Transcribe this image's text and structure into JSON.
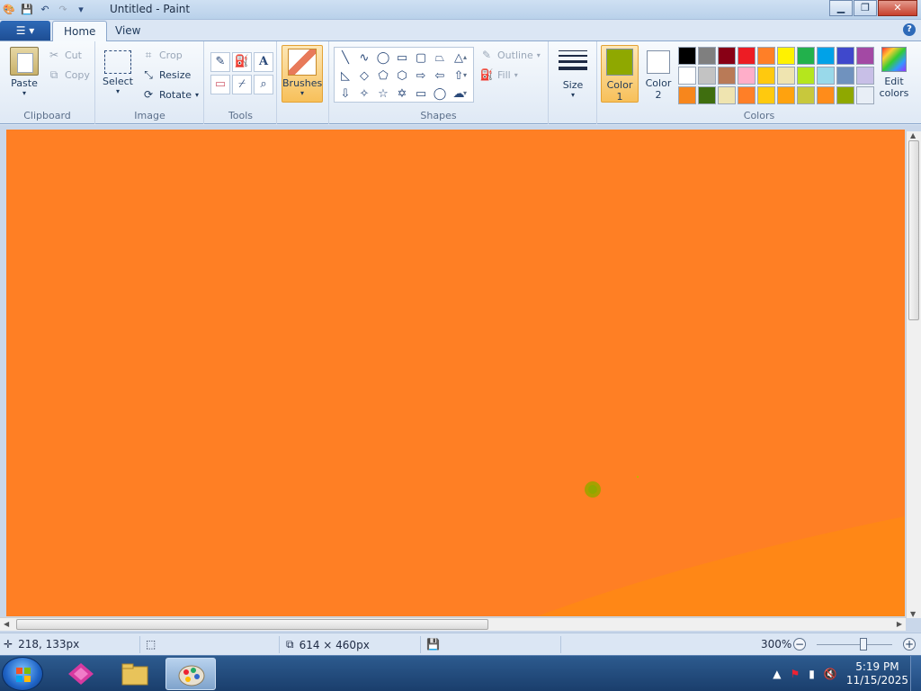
{
  "window": {
    "title": "Untitled - Paint",
    "minimize_icon": "minimize-icon",
    "maximize_icon": "restore-icon",
    "close_icon": "close-icon"
  },
  "tabs": {
    "home": "Home",
    "view": "View"
  },
  "ribbon": {
    "clipboard": {
      "label": "Clipboard",
      "paste": "Paste",
      "cut": "Cut",
      "copy": "Copy"
    },
    "image": {
      "label": "Image",
      "select": "Select",
      "crop": "Crop",
      "resize": "Resize",
      "rotate": "Rotate"
    },
    "tools": {
      "label": "Tools"
    },
    "brushes": {
      "label": "Brushes"
    },
    "shapes": {
      "label": "Shapes",
      "outline": "Outline",
      "fill": "Fill"
    },
    "size": {
      "label": "Size"
    },
    "colors": {
      "label": "Colors",
      "color1_line1": "Color",
      "color1_line2": "1",
      "color2_line1": "Color",
      "color2_line2": "2",
      "color1_value": "#8fa800",
      "color2_value": "#ffffff",
      "edit_line1": "Edit",
      "edit_line2": "colors",
      "palette": [
        "#000000",
        "#7f7f7f",
        "#880015",
        "#ed1c24",
        "#ff7f27",
        "#fff200",
        "#22b14c",
        "#00a2e8",
        "#3f48cc",
        "#a349a4",
        "#ffffff",
        "#c3c3c3",
        "#b97a57",
        "#ffaec9",
        "#ffc90e",
        "#efe4b0",
        "#b5e61d",
        "#99d9ea",
        "#7092be",
        "#c8bfe7",
        "#f7861c",
        "#3f6e0f",
        "#efe4b0",
        "#ff7f27",
        "#ffc90e",
        "#ffa20e",
        "#c8c83c",
        "#ff8c1a",
        "#8fa800",
        "#e8eef6"
      ]
    }
  },
  "canvas": {
    "background": "#ff7f24"
  },
  "status": {
    "cursor_pos": "218, 133px",
    "image_size": "614 × 460px",
    "zoom": "300%"
  },
  "taskbar": {
    "time": "5:19 PM",
    "date": "11/15/2025"
  }
}
